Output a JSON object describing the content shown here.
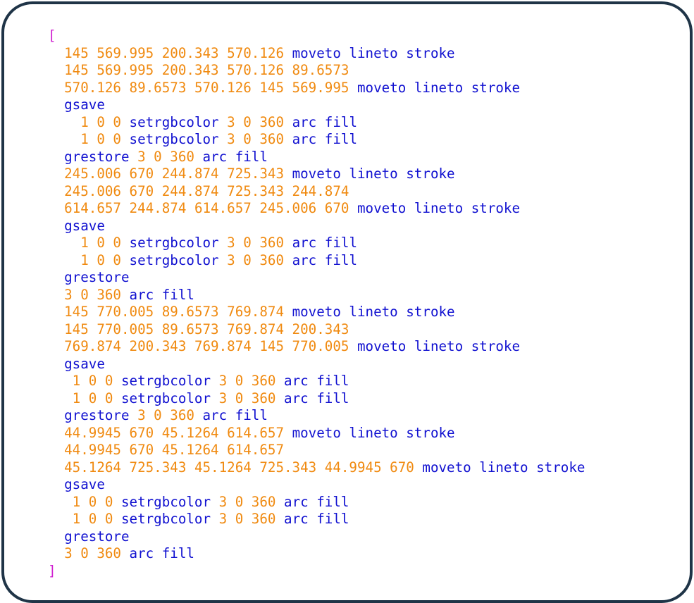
{
  "colors": {
    "bracket": "#d020d0",
    "number": "#f08a10",
    "keyword": "#1010d0",
    "frame_border": "#1f3447",
    "background": "#ffffff"
  },
  "code_lines": [
    {
      "indent": "",
      "tokens": [
        {
          "t": "[",
          "k": "bracket"
        }
      ]
    },
    {
      "indent": "  ",
      "tokens": [
        {
          "t": "145 569.995 200.343 570.126 ",
          "k": "number"
        },
        {
          "t": "moveto lineto stroke",
          "k": "keyword"
        }
      ]
    },
    {
      "indent": "  ",
      "tokens": [
        {
          "t": "145 569.995 200.343 570.126 89.6573",
          "k": "number"
        }
      ]
    },
    {
      "indent": "  ",
      "tokens": [
        {
          "t": "570.126 89.6573 570.126 145 569.995 ",
          "k": "number"
        },
        {
          "t": "moveto lineto stroke",
          "k": "keyword"
        }
      ]
    },
    {
      "indent": "  ",
      "tokens": [
        {
          "t": "gsave",
          "k": "keyword"
        }
      ]
    },
    {
      "indent": "    ",
      "tokens": [
        {
          "t": "1 0 0 ",
          "k": "number"
        },
        {
          "t": "setrgbcolor ",
          "k": "keyword"
        },
        {
          "t": "3 0 360 ",
          "k": "number"
        },
        {
          "t": "arc fill",
          "k": "keyword"
        }
      ]
    },
    {
      "indent": "    ",
      "tokens": [
        {
          "t": "1 0 0 ",
          "k": "number"
        },
        {
          "t": "setrgbcolor ",
          "k": "keyword"
        },
        {
          "t": "3 0 360 ",
          "k": "number"
        },
        {
          "t": "arc fill",
          "k": "keyword"
        }
      ]
    },
    {
      "indent": "  ",
      "tokens": [
        {
          "t": "grestore ",
          "k": "keyword"
        },
        {
          "t": "3 0 360 ",
          "k": "number"
        },
        {
          "t": "arc fill",
          "k": "keyword"
        }
      ]
    },
    {
      "indent": "  ",
      "tokens": [
        {
          "t": "245.006 670 244.874 725.343 ",
          "k": "number"
        },
        {
          "t": "moveto lineto stroke",
          "k": "keyword"
        }
      ]
    },
    {
      "indent": "  ",
      "tokens": [
        {
          "t": "245.006 670 244.874 725.343 244.874",
          "k": "number"
        }
      ]
    },
    {
      "indent": "  ",
      "tokens": [
        {
          "t": "614.657 244.874 614.657 245.006 670 ",
          "k": "number"
        },
        {
          "t": "moveto lineto stroke",
          "k": "keyword"
        }
      ]
    },
    {
      "indent": "  ",
      "tokens": [
        {
          "t": "gsave",
          "k": "keyword"
        }
      ]
    },
    {
      "indent": "    ",
      "tokens": [
        {
          "t": "1 0 0 ",
          "k": "number"
        },
        {
          "t": "setrgbcolor ",
          "k": "keyword"
        },
        {
          "t": "3 0 360 ",
          "k": "number"
        },
        {
          "t": "arc fill",
          "k": "keyword"
        }
      ]
    },
    {
      "indent": "    ",
      "tokens": [
        {
          "t": "1 0 0 ",
          "k": "number"
        },
        {
          "t": "setrgbcolor ",
          "k": "keyword"
        },
        {
          "t": "3 0 360 ",
          "k": "number"
        },
        {
          "t": "arc fill",
          "k": "keyword"
        }
      ]
    },
    {
      "indent": "  ",
      "tokens": [
        {
          "t": "grestore",
          "k": "keyword"
        }
      ]
    },
    {
      "indent": "  ",
      "tokens": [
        {
          "t": "3 0 360 ",
          "k": "number"
        },
        {
          "t": "arc fill",
          "k": "keyword"
        }
      ]
    },
    {
      "indent": "  ",
      "tokens": [
        {
          "t": "145 770.005 89.6573 769.874 ",
          "k": "number"
        },
        {
          "t": "moveto lineto stroke",
          "k": "keyword"
        }
      ]
    },
    {
      "indent": "  ",
      "tokens": [
        {
          "t": "145 770.005 89.6573 769.874 200.343",
          "k": "number"
        }
      ]
    },
    {
      "indent": "  ",
      "tokens": [
        {
          "t": "769.874 200.343 769.874 145 770.005 ",
          "k": "number"
        },
        {
          "t": "moveto lineto stroke",
          "k": "keyword"
        }
      ]
    },
    {
      "indent": "  ",
      "tokens": [
        {
          "t": "gsave",
          "k": "keyword"
        }
      ]
    },
    {
      "indent": "   ",
      "tokens": [
        {
          "t": "1 0 0 ",
          "k": "number"
        },
        {
          "t": "setrgbcolor ",
          "k": "keyword"
        },
        {
          "t": "3 0 360 ",
          "k": "number"
        },
        {
          "t": "arc fill",
          "k": "keyword"
        }
      ]
    },
    {
      "indent": "   ",
      "tokens": [
        {
          "t": "1 0 0 ",
          "k": "number"
        },
        {
          "t": "setrgbcolor ",
          "k": "keyword"
        },
        {
          "t": "3 0 360 ",
          "k": "number"
        },
        {
          "t": "arc fill",
          "k": "keyword"
        }
      ]
    },
    {
      "indent": "  ",
      "tokens": [
        {
          "t": "grestore ",
          "k": "keyword"
        },
        {
          "t": "3 0 360 ",
          "k": "number"
        },
        {
          "t": "arc fill",
          "k": "keyword"
        }
      ]
    },
    {
      "indent": "  ",
      "tokens": [
        {
          "t": "44.9945 670 45.1264 614.657 ",
          "k": "number"
        },
        {
          "t": "moveto lineto stroke",
          "k": "keyword"
        }
      ]
    },
    {
      "indent": "  ",
      "tokens": [
        {
          "t": "44.9945 670 45.1264 614.657",
          "k": "number"
        }
      ]
    },
    {
      "indent": "  ",
      "tokens": [
        {
          "t": "45.1264 725.343 45.1264 725.343 44.9945 670 ",
          "k": "number"
        },
        {
          "t": "moveto lineto stroke",
          "k": "keyword"
        }
      ]
    },
    {
      "indent": "  ",
      "tokens": [
        {
          "t": "gsave",
          "k": "keyword"
        }
      ]
    },
    {
      "indent": "   ",
      "tokens": [
        {
          "t": "1 0 0 ",
          "k": "number"
        },
        {
          "t": "setrgbcolor ",
          "k": "keyword"
        },
        {
          "t": "3 0 360 ",
          "k": "number"
        },
        {
          "t": "arc fill",
          "k": "keyword"
        }
      ]
    },
    {
      "indent": "   ",
      "tokens": [
        {
          "t": "1 0 0 ",
          "k": "number"
        },
        {
          "t": "setrgbcolor ",
          "k": "keyword"
        },
        {
          "t": "3 0 360 ",
          "k": "number"
        },
        {
          "t": "arc fill",
          "k": "keyword"
        }
      ]
    },
    {
      "indent": "  ",
      "tokens": [
        {
          "t": "grestore",
          "k": "keyword"
        }
      ]
    },
    {
      "indent": "  ",
      "tokens": [
        {
          "t": "3 0 360 ",
          "k": "number"
        },
        {
          "t": "arc fill",
          "k": "keyword"
        }
      ]
    },
    {
      "indent": "",
      "tokens": [
        {
          "t": "]",
          "k": "bracket"
        }
      ]
    }
  ]
}
